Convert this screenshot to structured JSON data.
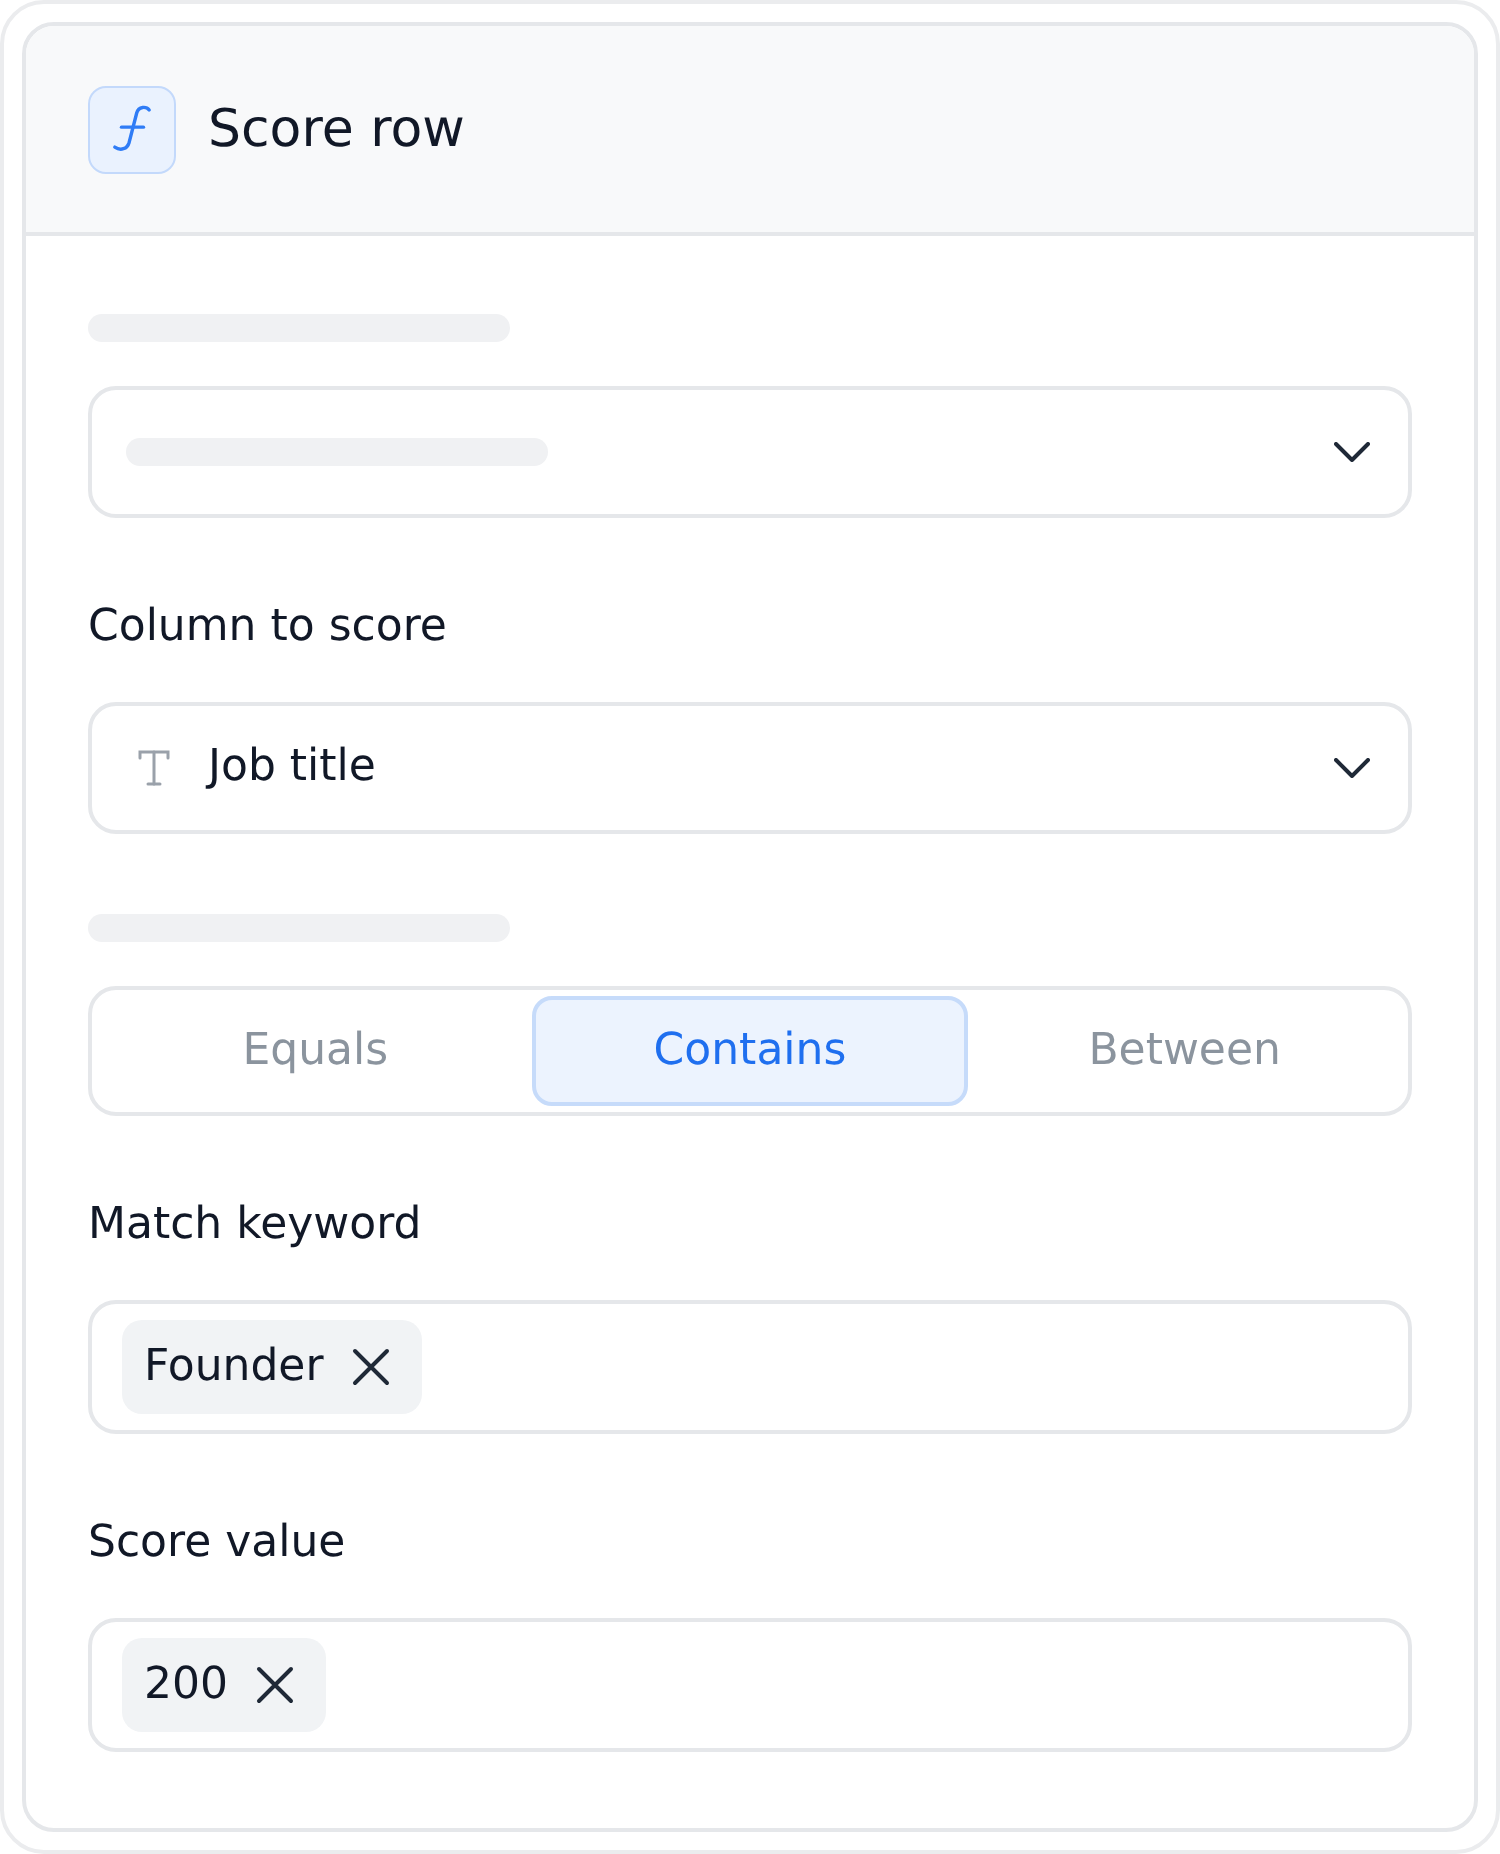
{
  "panel": {
    "title": "Score row"
  },
  "fields": [
    {
      "kind": "select",
      "label_loading": true,
      "value_loading": true
    },
    {
      "kind": "select",
      "label_loading": false,
      "label": "Column to score",
      "value_loading": false,
      "value": "Job title"
    },
    {
      "kind": "segmented",
      "label_loading": true,
      "options": [
        {
          "label": "Equals",
          "selected": false
        },
        {
          "label": "Contains",
          "selected": true
        },
        {
          "label": "Between",
          "selected": false
        }
      ]
    },
    {
      "kind": "tags",
      "label_loading": false,
      "label": "Match keyword",
      "tags": [
        "Founder"
      ]
    },
    {
      "kind": "tags",
      "label_loading": false,
      "label": "Score value",
      "tags": [
        "200"
      ]
    }
  ]
}
